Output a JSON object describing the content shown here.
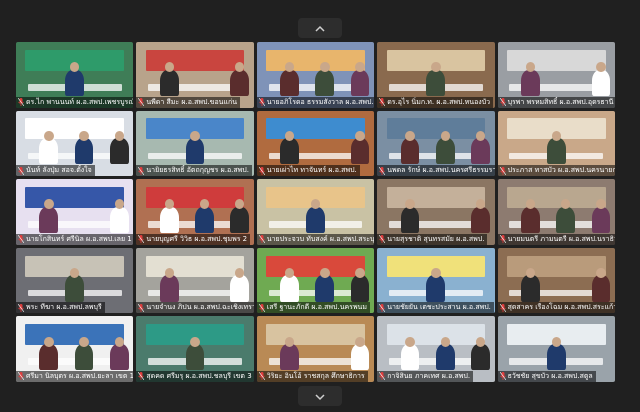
{
  "participants": [
    {
      "name": "ดร.ไก พานนนท์ ผ.อ.สพป.เพชรบูรณ์",
      "bg": "#3f7d57",
      "banner": "#2e9b6a"
    },
    {
      "name": "นพีดา สีมะ ผ.อ.สพป.ขอนแก่น",
      "bg": "#b8a38b",
      "banner": "#c9453f"
    },
    {
      "name": "นายอภิโรดอ ธรรมสังวาล ผ.อ.สพป.",
      "bg": "#7f93b8",
      "banner": "#e8b56c"
    },
    {
      "name": "ดร.อุไร นิ่มก.ท. ผ.อ.สพป.หนองบัว",
      "bg": "#8a6a4e",
      "banner": "#d9c4a0"
    },
    {
      "name": "บุรพา พรหมสิทธิ์ ผ.อ.สพป.อุดรธานี",
      "bg": "#9a9ea3",
      "banner": "#d8d8d8"
    },
    {
      "name": "นันท์ ลังปุ่ม สอจ.ตั้งใจ",
      "bg": "#d8dde4",
      "banner": "#ffffff"
    },
    {
      "name": "นายิยธรสิทธิ์ อัตถกุญชร ผ.อ.สพป.",
      "bg": "#a7b9b0",
      "banner": "#4a86c9"
    },
    {
      "name": "นายเผ่าไท ทาจันทร์ ผ.อ.สพป.",
      "bg": "#b06b3f",
      "banner": "#3e8ccf"
    },
    {
      "name": "นพดล รักษ์ ผ.อ.สพป.นครศรีธรรมราช",
      "bg": "#7b8fa3",
      "banner": "#5f7d9a"
    },
    {
      "name": "ประภาส ทาสบัว ผ.อ.สพป.นครนายก",
      "bg": "#c9a889",
      "banner": "#e9ddc9"
    },
    {
      "name": "นายโกสินทร์ ศรีนิล ผ.อ.สพป.เลย 1",
      "bg": "#e7e0f0",
      "banner": "#3657a8"
    },
    {
      "name": "นายบุญศรี วิวิธ ผ.อ.สพป.ชุมพร 2",
      "bg": "#b07052",
      "banner": "#cf3c3c"
    },
    {
      "name": "นายประจวบ ทับสงค์ ผ.อ.สพป.สระบุรี",
      "bg": "#c9c2a4",
      "banner": "#e8c48a"
    },
    {
      "name": "นายสุรชาติ สุนทรสมัย ผ.อ.สพป.",
      "bg": "#8b7663",
      "banner": "#c4b09a"
    },
    {
      "name": "นายมนตรี ภามนตรี ผ.อ.สพป.นราธิวาส",
      "bg": "#8d7b70",
      "banner": "#b9a78f"
    },
    {
      "name": "พระ ทีฆา ผ.อ.สพป.ลพบุรี",
      "bg": "#6d6e74",
      "banner": "#c7c2b6"
    },
    {
      "name": "นายจำนง ภิปน ผ.อ.สพป.ฉะเชิงเทรา",
      "bg": "#a4a39d",
      "banner": "#e3dfd2"
    },
    {
      "name": "เสรี ฐานะภักดี ผ.อ.สพป.นครพนม",
      "bg": "#6faa52",
      "banner": "#d9493b"
    },
    {
      "name": "นายชัยยัน เตชะประสาน ผ.อ.สพป.",
      "bg": "#8ab1d0",
      "banner": "#f0e17a"
    },
    {
      "name": "สุดสาคร เรืองโฉม ผ.อ.สพป.สระแก้ว",
      "bg": "#8c6d52",
      "banner": "#b99b7b"
    },
    {
      "name": "ศรีมา นิลบุตร ผ.อ.สพป.ยะลา เขต 1",
      "bg": "#f0f0f0",
      "banner": "#3b73b9"
    },
    {
      "name": "สุดคด ศรีมรุ ผ.อ.สพป.ชลบุรี เขต 3",
      "bg": "#4b7b6c",
      "banner": "#2d9a86"
    },
    {
      "name": "วิริยะ อินโอ้ ราชสกุล ศึกษาธิการ",
      "bg": "#b98a55",
      "banner": "#d8c3a0"
    },
    {
      "name": "กาจิสินย ภาคเทศ ผ.อ.สพป.",
      "bg": "#b9bec4",
      "banner": "#dce2e8"
    },
    {
      "name": "ธวัชชัย สุขบัว ผ.อ.สพป.สตูล",
      "bg": "#9aa3aa",
      "banner": "#e8edf0"
    }
  ],
  "icons": {
    "nav_up": "chevron-up-icon",
    "nav_down": "chevron-down-icon",
    "mic": "microphone-icon"
  },
  "colors": {
    "background": "#202020",
    "nameplate": "#000000",
    "accent": "#e03c3c"
  }
}
